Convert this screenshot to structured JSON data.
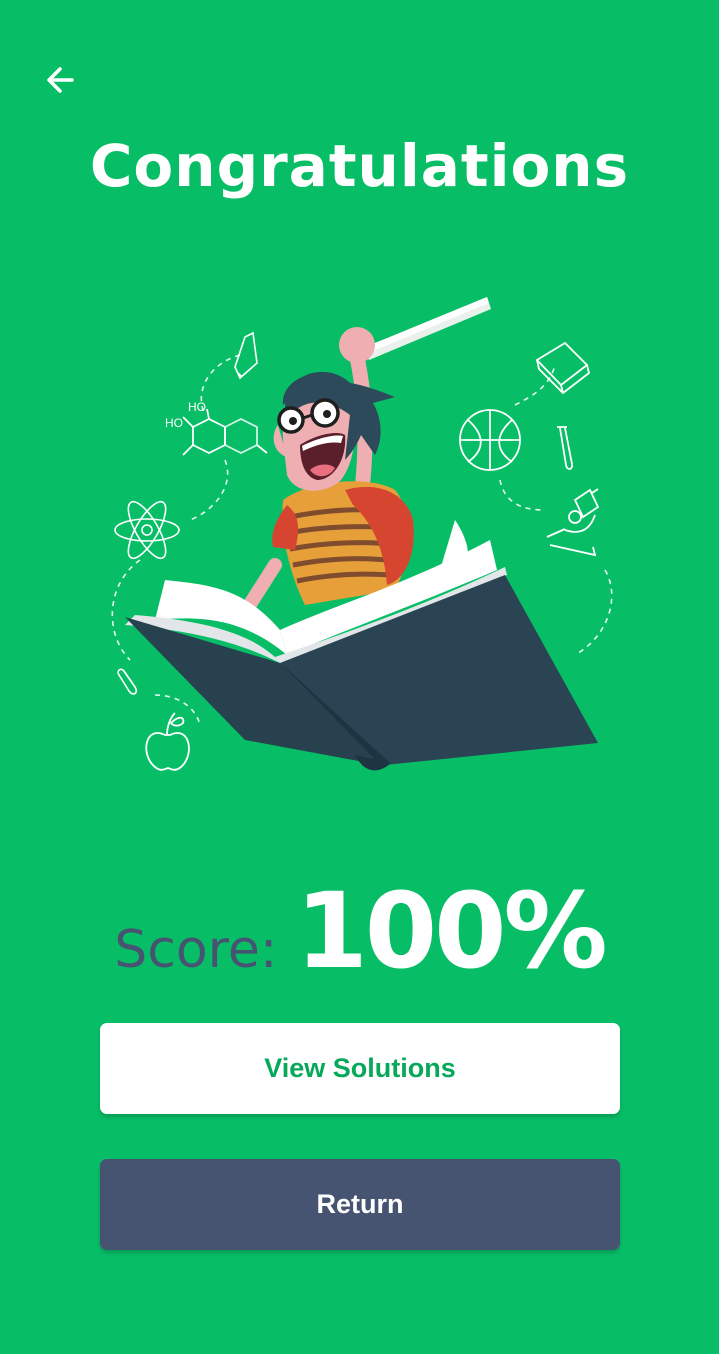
{
  "header": {
    "back_icon": "arrow-left-icon",
    "title": "Congratulations"
  },
  "illustration": {
    "description_icon": "student-reading-book-illustration",
    "doodles": [
      "pencil-icon",
      "molecule-icon",
      "atom-icon",
      "paperclip-icon",
      "apple-icon",
      "basketball-icon",
      "book-icon",
      "test-tube-icon",
      "microscope-icon"
    ],
    "molecule_labels": [
      "HO",
      "HO"
    ]
  },
  "score": {
    "label": "Score:",
    "value": "100%"
  },
  "actions": {
    "view_solutions_label": "View Solutions",
    "return_label": "Return"
  },
  "colors": {
    "background": "#07BE67",
    "accent_dark": "#475471",
    "button_text_green": "#07A85A"
  }
}
